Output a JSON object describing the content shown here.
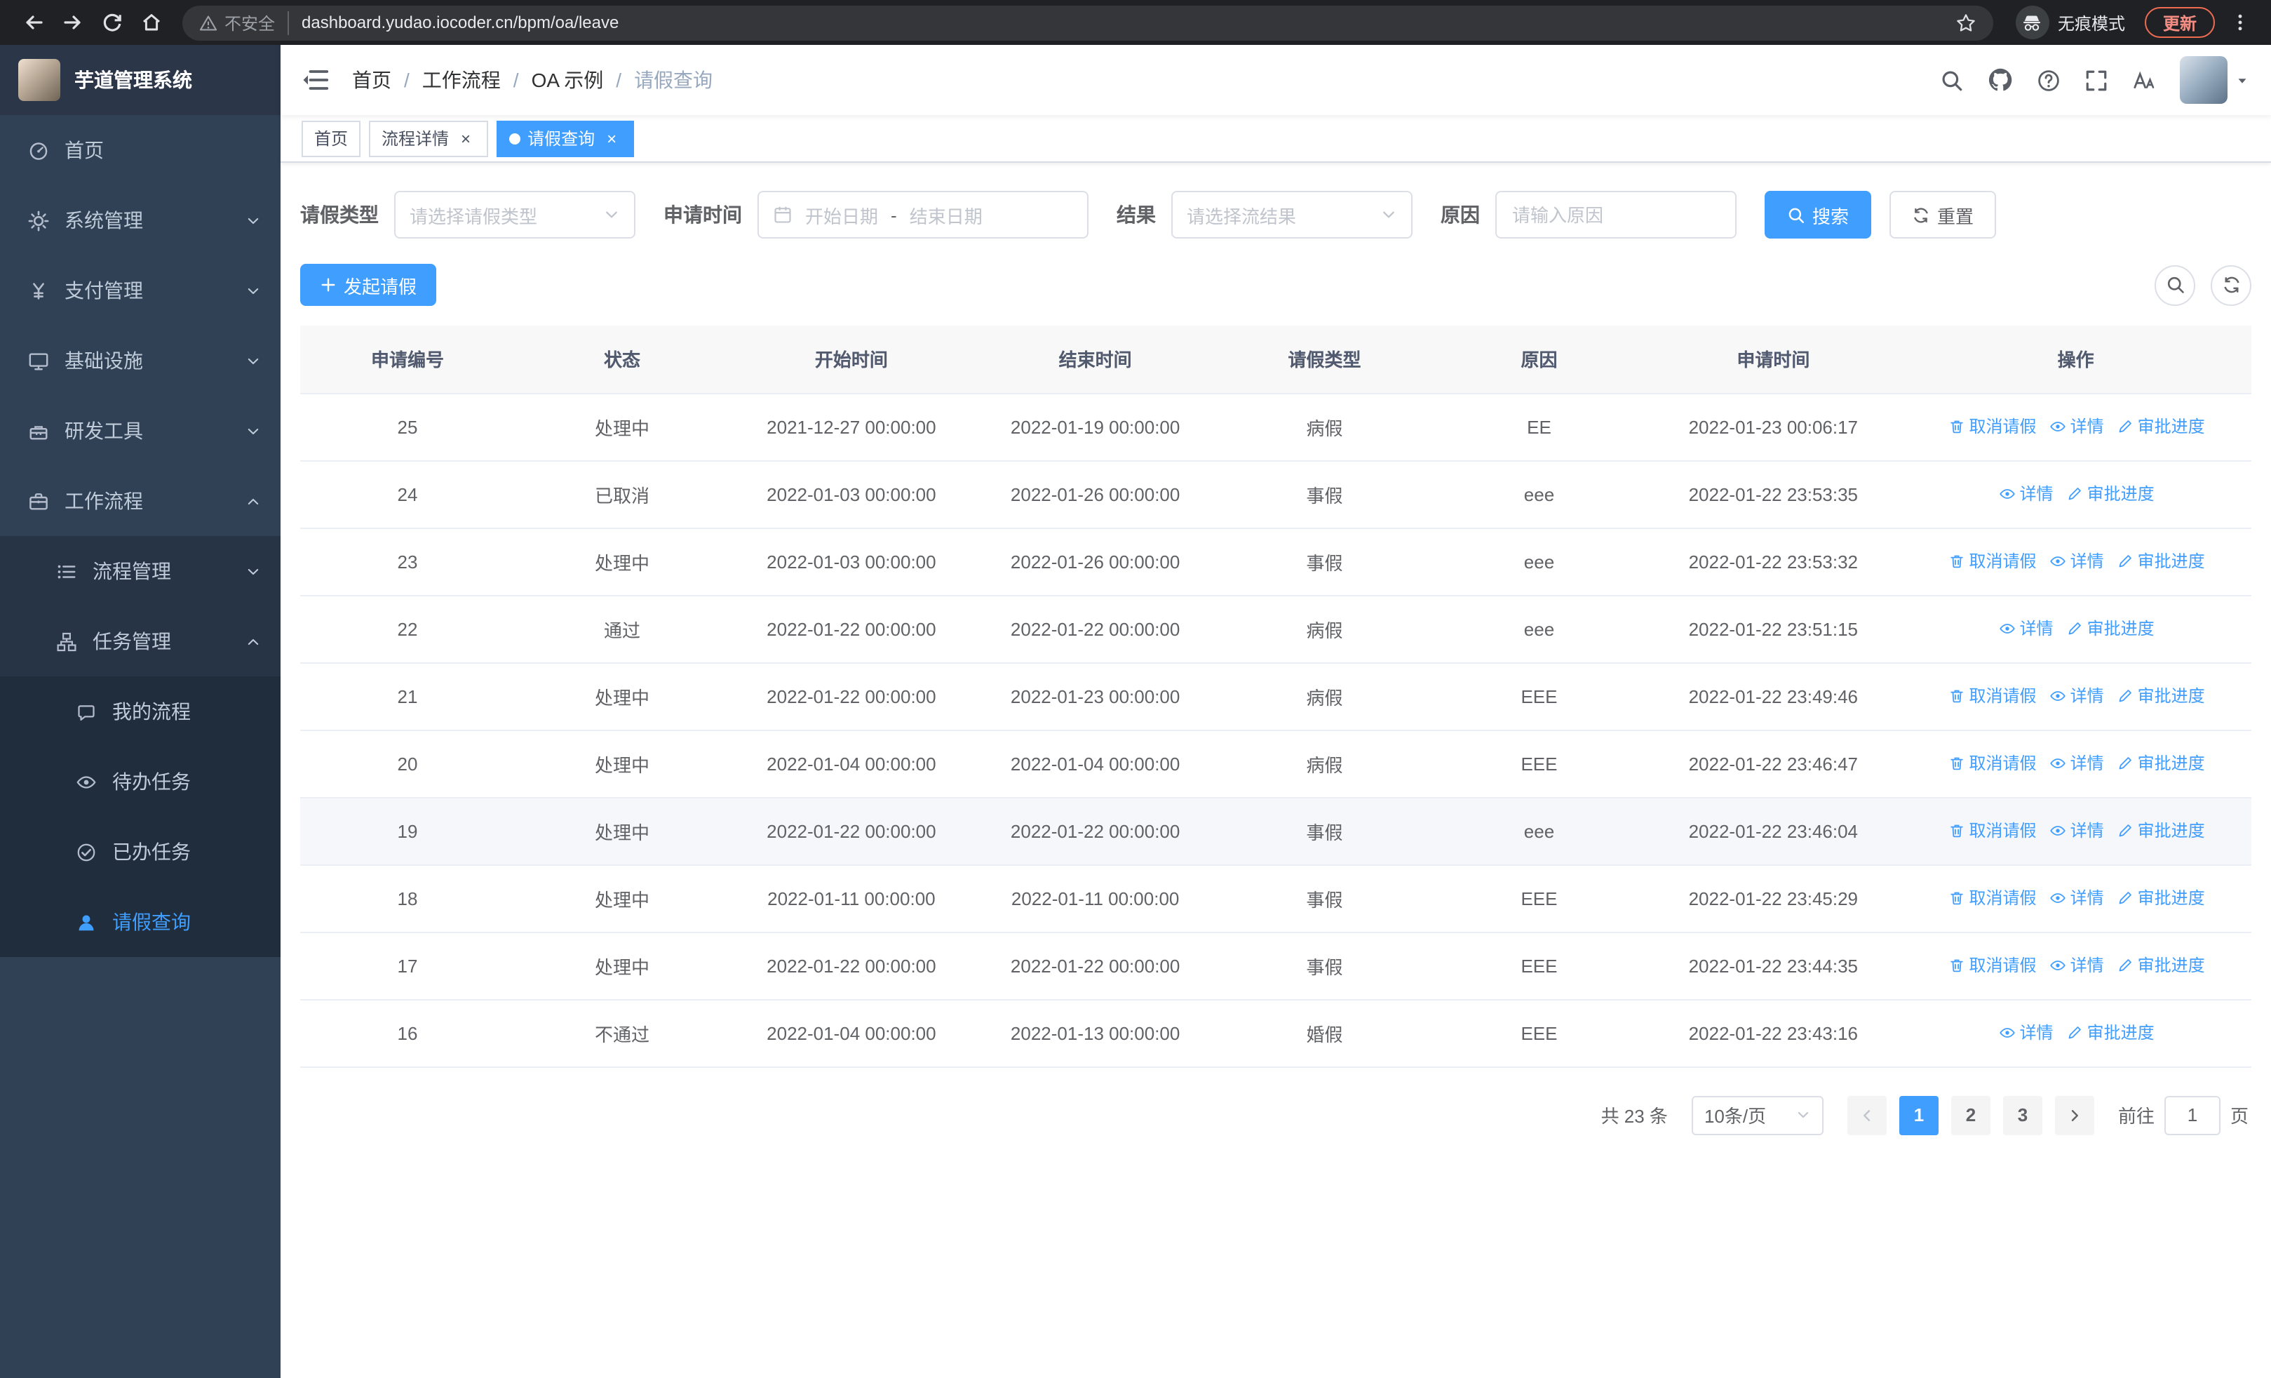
{
  "theme": {
    "accent": "#409EFF",
    "sidebar_bg": "#304156",
    "chrome_bg": "#202124",
    "active_tab_bg": "#409EFF",
    "link_color": "#409EFF"
  },
  "browser": {
    "security_label": "不安全",
    "url": "dashboard.yudao.iocoder.cn/bpm/oa/leave",
    "incognito_label": "无痕模式",
    "update_label": "更新"
  },
  "sidebar": {
    "logo_title": "芋道管理系统",
    "menu": [
      {
        "label": "首页",
        "icon": "dashboard-icon",
        "level": 1
      },
      {
        "label": "系统管理",
        "icon": "gear-icon",
        "level": 1,
        "chevron": "down"
      },
      {
        "label": "支付管理",
        "icon": "yen-icon",
        "level": 1,
        "chevron": "down"
      },
      {
        "label": "基础设施",
        "icon": "monitor-icon",
        "level": 1,
        "chevron": "down"
      },
      {
        "label": "研发工具",
        "icon": "toolbox-icon",
        "level": 1,
        "chevron": "down"
      },
      {
        "label": "工作流程",
        "icon": "briefcase-icon",
        "level": 1,
        "chevron": "up"
      },
      {
        "label": "流程管理",
        "icon": "list-icon",
        "level": 2,
        "chevron": "down"
      },
      {
        "label": "任务管理",
        "icon": "org-icon",
        "level": 2,
        "chevron": "up"
      },
      {
        "label": "我的流程",
        "icon": "chat-icon",
        "level": 3
      },
      {
        "label": "待办任务",
        "icon": "eye-icon",
        "level": 3
      },
      {
        "label": "已办任务",
        "icon": "check-icon",
        "level": 3
      },
      {
        "label": "请假查询",
        "icon": "user-icon",
        "level": 3,
        "active": true
      }
    ]
  },
  "header": {
    "breadcrumb": [
      "首页",
      "工作流程",
      "OA 示例",
      "请假查询"
    ]
  },
  "tabs": [
    {
      "label": "首页"
    },
    {
      "label": "流程详情",
      "closable": true
    },
    {
      "label": "请假查询",
      "closable": true,
      "active": true
    }
  ],
  "filters": {
    "leave_type_label": "请假类型",
    "leave_type_placeholder": "请选择请假类型",
    "apply_time_label": "申请时间",
    "start_date_placeholder": "开始日期",
    "date_separator": "-",
    "end_date_placeholder": "结束日期",
    "result_label": "结果",
    "result_placeholder": "请选择流结果",
    "reason_label": "原因",
    "reason_placeholder": "请输入原因",
    "search_label": "搜索",
    "reset_label": "重置"
  },
  "toolbar": {
    "create_label": "发起请假"
  },
  "table": {
    "columns": [
      "申请编号",
      "状态",
      "开始时间",
      "结束时间",
      "请假类型",
      "原因",
      "申请时间",
      "操作"
    ],
    "action_labels": {
      "cancel": "取消请假",
      "detail": "详情",
      "progress": "审批进度"
    },
    "action_icons": {
      "cancel": "delete-icon",
      "detail": "eye-icon",
      "progress": "edit-icon"
    },
    "rows": [
      {
        "id": "25",
        "status": "处理中",
        "start": "2021-12-27 00:00:00",
        "end": "2022-01-19 00:00:00",
        "type": "病假",
        "reason": "EE",
        "applied": "2022-01-23 00:06:17",
        "actions": [
          "cancel",
          "detail",
          "progress"
        ]
      },
      {
        "id": "24",
        "status": "已取消",
        "start": "2022-01-03 00:00:00",
        "end": "2022-01-26 00:00:00",
        "type": "事假",
        "reason": "eee",
        "applied": "2022-01-22 23:53:35",
        "actions": [
          "detail",
          "progress"
        ]
      },
      {
        "id": "23",
        "status": "处理中",
        "start": "2022-01-03 00:00:00",
        "end": "2022-01-26 00:00:00",
        "type": "事假",
        "reason": "eee",
        "applied": "2022-01-22 23:53:32",
        "actions": [
          "cancel",
          "detail",
          "progress"
        ]
      },
      {
        "id": "22",
        "status": "通过",
        "start": "2022-01-22 00:00:00",
        "end": "2022-01-22 00:00:00",
        "type": "病假",
        "reason": "eee",
        "applied": "2022-01-22 23:51:15",
        "actions": [
          "detail",
          "progress"
        ]
      },
      {
        "id": "21",
        "status": "处理中",
        "start": "2022-01-22 00:00:00",
        "end": "2022-01-23 00:00:00",
        "type": "病假",
        "reason": "EEE",
        "applied": "2022-01-22 23:49:46",
        "actions": [
          "cancel",
          "detail",
          "progress"
        ]
      },
      {
        "id": "20",
        "status": "处理中",
        "start": "2022-01-04 00:00:00",
        "end": "2022-01-04 00:00:00",
        "type": "病假",
        "reason": "EEE",
        "applied": "2022-01-22 23:46:47",
        "actions": [
          "cancel",
          "detail",
          "progress"
        ]
      },
      {
        "id": "19",
        "status": "处理中",
        "start": "2022-01-22 00:00:00",
        "end": "2022-01-22 00:00:00",
        "type": "事假",
        "reason": "eee",
        "applied": "2022-01-22 23:46:04",
        "actions": [
          "cancel",
          "detail",
          "progress"
        ],
        "highlighted": true
      },
      {
        "id": "18",
        "status": "处理中",
        "start": "2022-01-11 00:00:00",
        "end": "2022-01-11 00:00:00",
        "type": "事假",
        "reason": "EEE",
        "applied": "2022-01-22 23:45:29",
        "actions": [
          "cancel",
          "detail",
          "progress"
        ]
      },
      {
        "id": "17",
        "status": "处理中",
        "start": "2022-01-22 00:00:00",
        "end": "2022-01-22 00:00:00",
        "type": "事假",
        "reason": "EEE",
        "applied": "2022-01-22 23:44:35",
        "actions": [
          "cancel",
          "detail",
          "progress"
        ]
      },
      {
        "id": "16",
        "status": "不通过",
        "start": "2022-01-04 00:00:00",
        "end": "2022-01-13 00:00:00",
        "type": "婚假",
        "reason": "EEE",
        "applied": "2022-01-22 23:43:16",
        "actions": [
          "detail",
          "progress"
        ]
      }
    ]
  },
  "pagination": {
    "total_text": "共 23 条",
    "page_size": "10条/页",
    "pages": [
      "1",
      "2",
      "3"
    ],
    "active_page": "1",
    "goto_label": "前往",
    "goto_value": "1",
    "unit_label": "页"
  }
}
